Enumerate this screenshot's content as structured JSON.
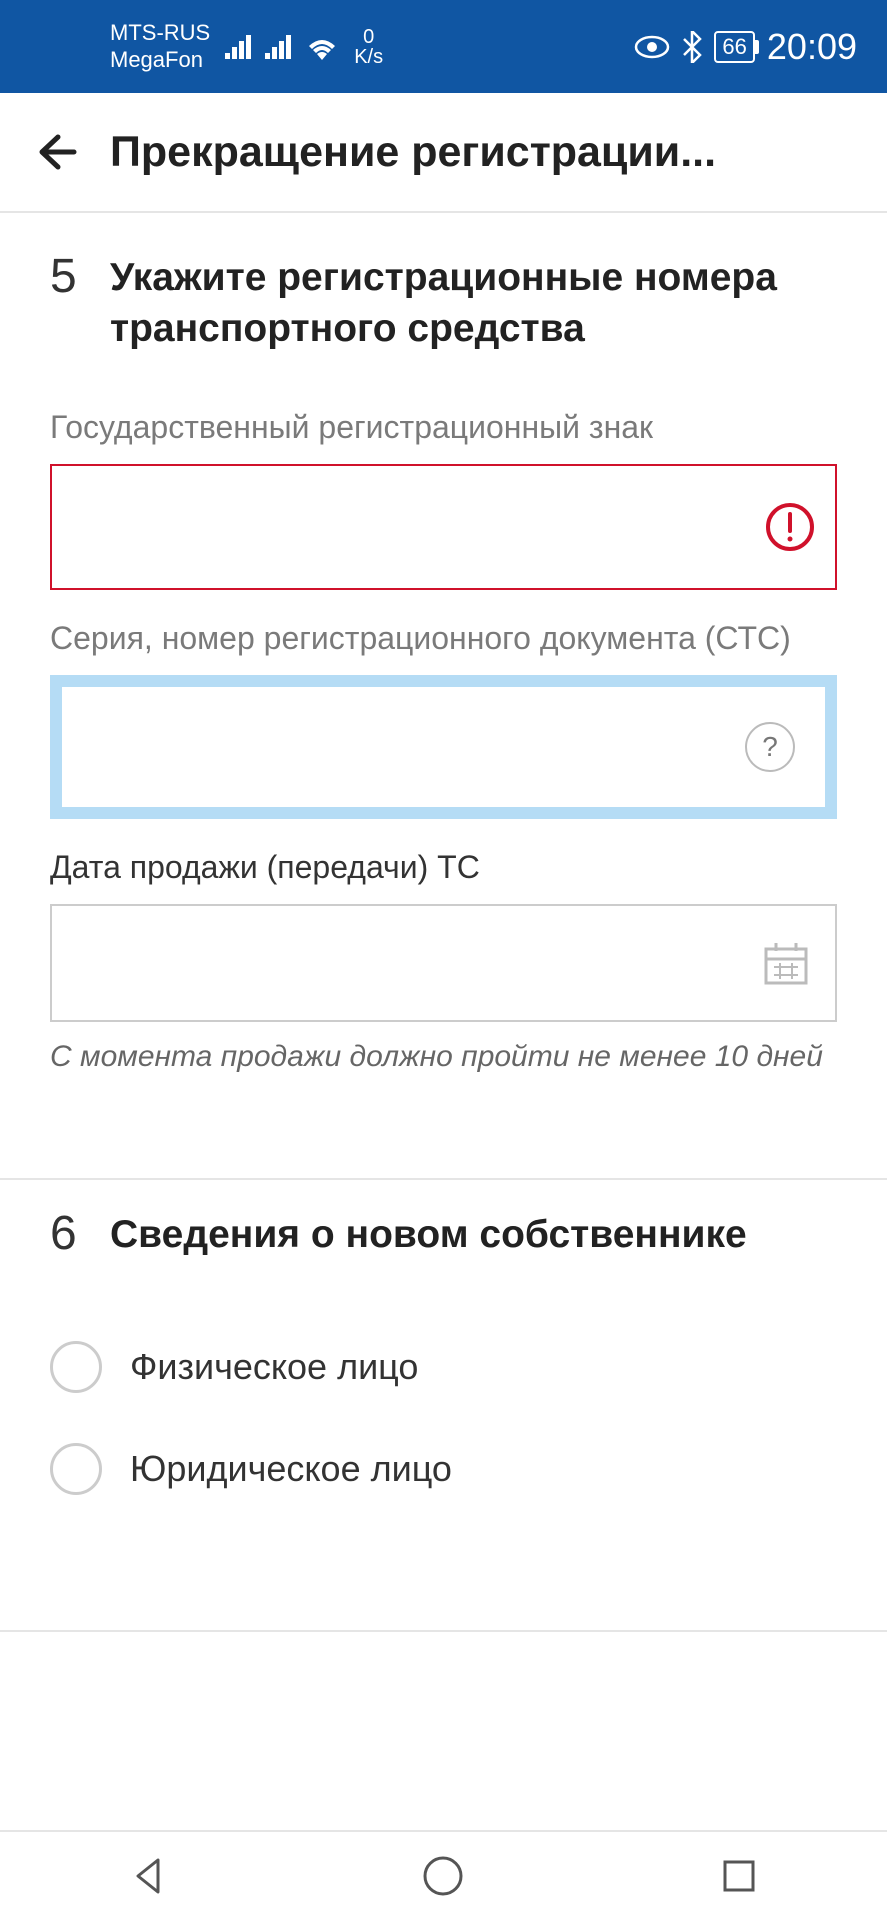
{
  "status_bar": {
    "carrier1": "MTS-RUS",
    "carrier2": "MegaFon",
    "data_amount": "0",
    "data_unit": "K/s",
    "battery": "66",
    "time": "20:09"
  },
  "header": {
    "title": "Прекращение регистрации..."
  },
  "section5": {
    "number": "5",
    "title": "Укажите регистрационные номера транспортного средства",
    "field1_label": "Государственный регистрационный знак",
    "field1_value": "",
    "field2_label": "Серия, номер регистрационного документа (СТС)",
    "field2_value": "",
    "field3_label": "Дата продажи (передачи) ТС",
    "field3_value": "",
    "field3_hint": "С момента продажи должно пройти не менее 10 дней"
  },
  "section6": {
    "number": "6",
    "title": "Сведения о новом собственнике",
    "option1": "Физическое лицо",
    "option2": "Юридическое лицо"
  },
  "help_symbol": "?"
}
